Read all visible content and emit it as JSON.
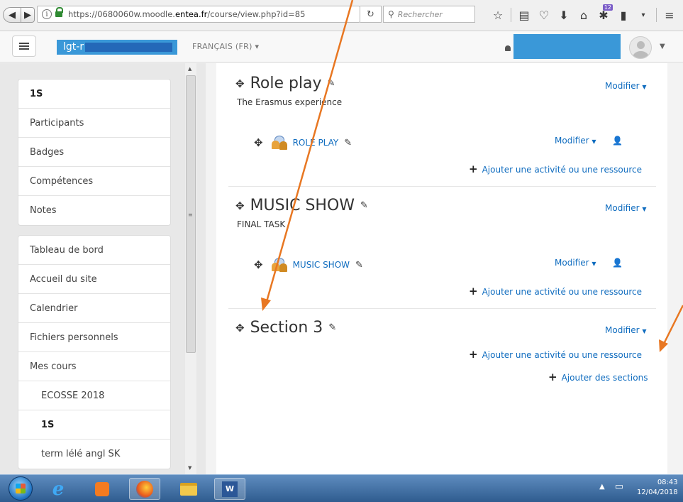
{
  "browser": {
    "url_prefix": "https://0680060w.moodle.",
    "url_host": "entea.fr",
    "url_path": "/course/view.php?id=85",
    "search_placeholder": "Rechercher",
    "notification_count": "12"
  },
  "navbar": {
    "site_name": "lgt-r",
    "language": "FRANÇAIS (FR) ▾"
  },
  "sidebar": {
    "block1": [
      "1S",
      "Participants",
      "Badges",
      "Compétences",
      "Notes"
    ],
    "block2": [
      "Tableau de bord",
      "Accueil du site",
      "Calendrier",
      "Fichiers personnels",
      "Mes cours",
      "ECOSSE 2018",
      "1S",
      "term lélé angl SK"
    ]
  },
  "sections": [
    {
      "title": "Role play",
      "summary": "The Erasmus experience",
      "modifier": "Modifier",
      "activity": "ROLE PLAY",
      "activity_modifier": "Modifier",
      "add_link": "Ajouter une activité ou une ressource"
    },
    {
      "title": "MUSIC SHOW",
      "summary": "FINAL TASK",
      "modifier": "Modifier",
      "activity": "MUSIC SHOW",
      "activity_modifier": "Modifier",
      "add_link": "Ajouter une activité ou une ressource"
    },
    {
      "title": "Section 3",
      "modifier": "Modifier",
      "add_link": "Ajouter une activité ou une ressource",
      "add_sections": "Ajouter des sections"
    }
  ],
  "taskbar": {
    "time": "08:43",
    "date": "12/04/2018"
  },
  "colors": {
    "link": "#0f6cbf",
    "annotation_arrow": "#e87722",
    "redaction": "#3a98d8"
  }
}
